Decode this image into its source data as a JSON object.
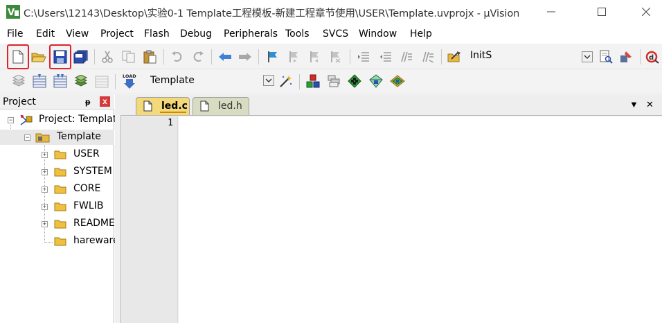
{
  "window": {
    "title": "C:\\Users\\12143\\Desktop\\实验0-1 Template工程模板-新建工程章节使用\\USER\\Template.uvprojx - µVision",
    "minimize_glyph": "—",
    "maximize_glyph": "☐",
    "close_glyph": "✕"
  },
  "menu": [
    "File",
    "Edit",
    "View",
    "Project",
    "Flash",
    "Debug",
    "Peripherals",
    "Tools",
    "SVCS",
    "Window",
    "Help"
  ],
  "toolbar1": {
    "search_combo_value": "InitS",
    "highlighted": [
      "new-file-button",
      "save-button"
    ],
    "accent": "#e0232b"
  },
  "toolbar2": {
    "load_label": "LOAD",
    "target_combo_value": "Template"
  },
  "project_panel": {
    "title": "Project",
    "pin_glyph": "ᵽ",
    "close_glyph": "x",
    "root": "Project: Template",
    "target": "Template",
    "groups": [
      "USER",
      "SYSTEM",
      "CORE",
      "FWLIB",
      "README",
      "hareware"
    ]
  },
  "editor": {
    "tabs": [
      {
        "label": "led.c",
        "active": true
      },
      {
        "label": "led.h",
        "active": false
      }
    ],
    "menu_glyph": "▼",
    "close_glyph": "✕",
    "line_numbers": [
      "1"
    ]
  }
}
